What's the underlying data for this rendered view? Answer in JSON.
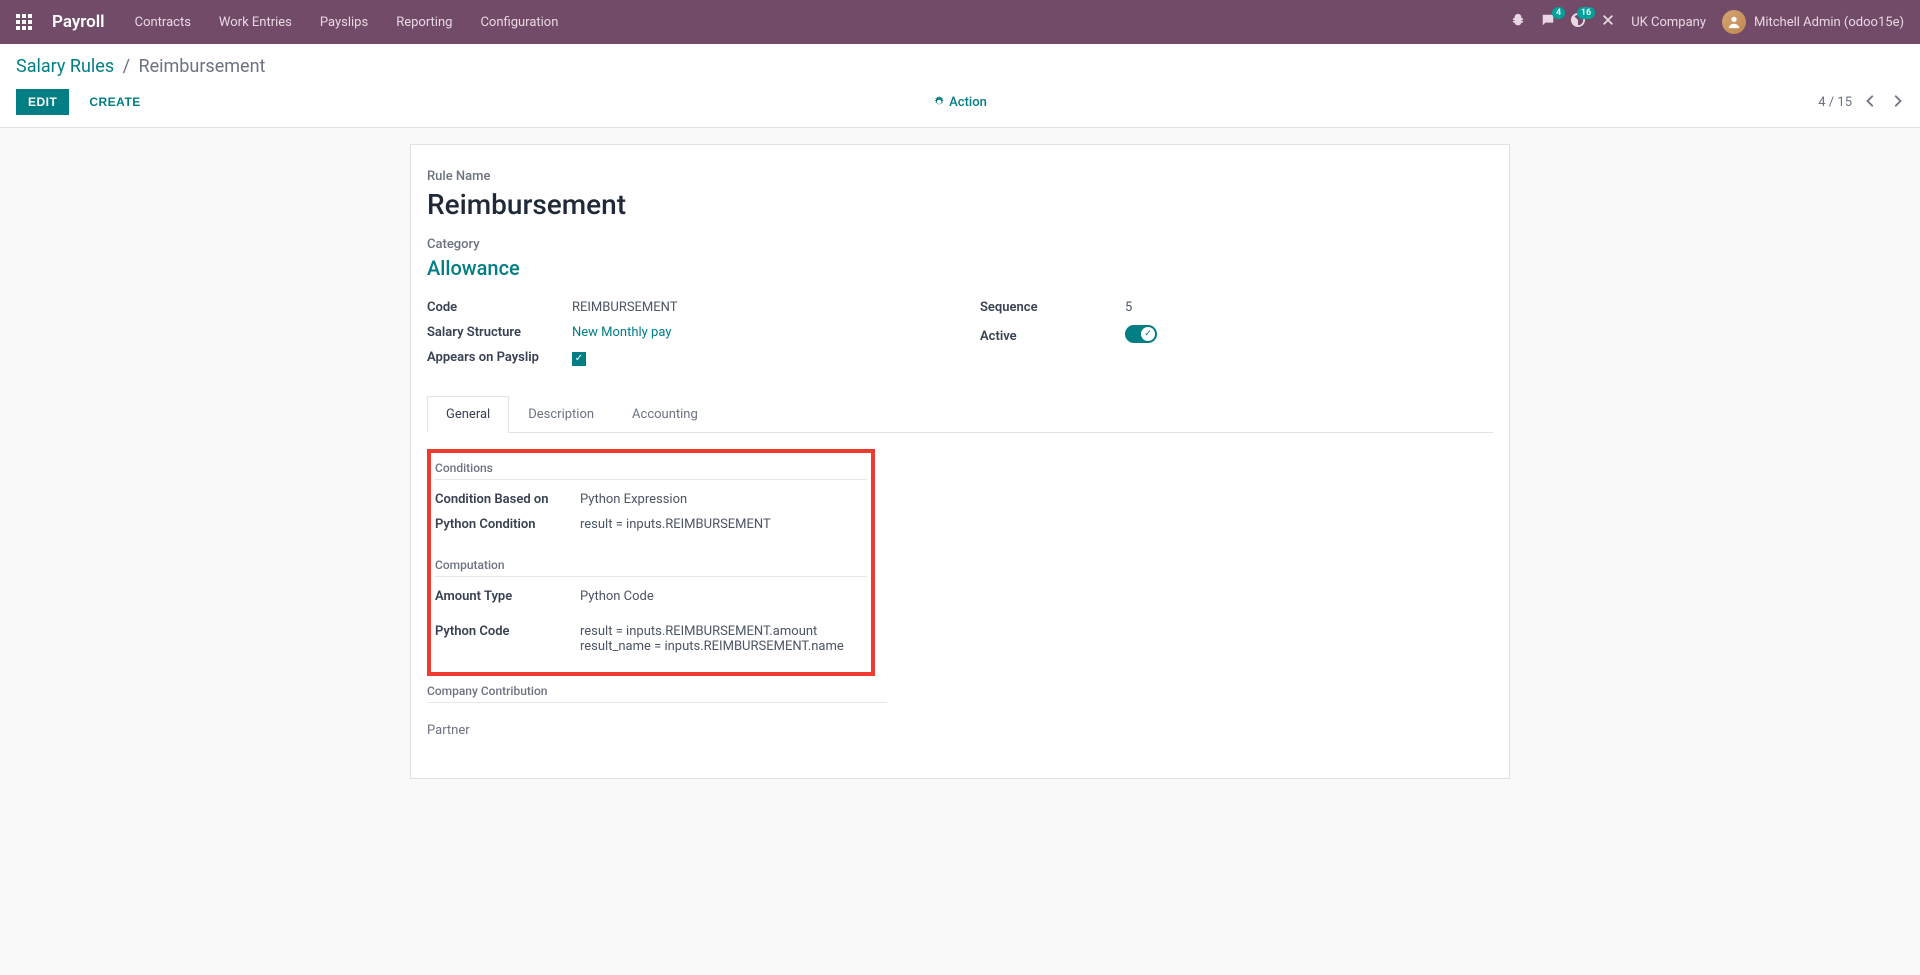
{
  "nav": {
    "app": "Payroll",
    "menu": [
      "Contracts",
      "Work Entries",
      "Payslips",
      "Reporting",
      "Configuration"
    ],
    "msg_badge": "4",
    "act_badge": "16",
    "company": "UK Company",
    "user": "Mitchell Admin (odoo15e)"
  },
  "breadcrumb": {
    "parent": "Salary Rules",
    "current": "Reimbursement"
  },
  "controls": {
    "edit": "EDIT",
    "create": "CREATE",
    "action": "Action",
    "pager": "4 / 15"
  },
  "form": {
    "rule_name_label": "Rule Name",
    "rule_name": "Reimbursement",
    "category_label": "Category",
    "category": "Allowance",
    "code_label": "Code",
    "code": "REIMBURSEMENT",
    "salary_structure_label": "Salary Structure",
    "salary_structure": "New Monthly pay",
    "appears_payslip_label": "Appears on Payslip",
    "sequence_label": "Sequence",
    "sequence": "5",
    "active_label": "Active"
  },
  "tabs": {
    "general": "General",
    "description": "Description",
    "accounting": "Accounting"
  },
  "general_tab": {
    "conditions_title": "Conditions",
    "condition_based_label": "Condition Based on",
    "condition_based_val": "Python Expression",
    "python_condition_label": "Python Condition",
    "python_condition_val": "result = inputs.REIMBURSEMENT",
    "computation_title": "Computation",
    "amount_type_label": "Amount Type",
    "amount_type_val": "Python Code",
    "python_code_label": "Python Code",
    "python_code_val": "result = inputs.REIMBURSEMENT.amount\nresult_name = inputs.REIMBURSEMENT.name",
    "company_contribution_title": "Company Contribution",
    "partner_label": "Partner"
  }
}
